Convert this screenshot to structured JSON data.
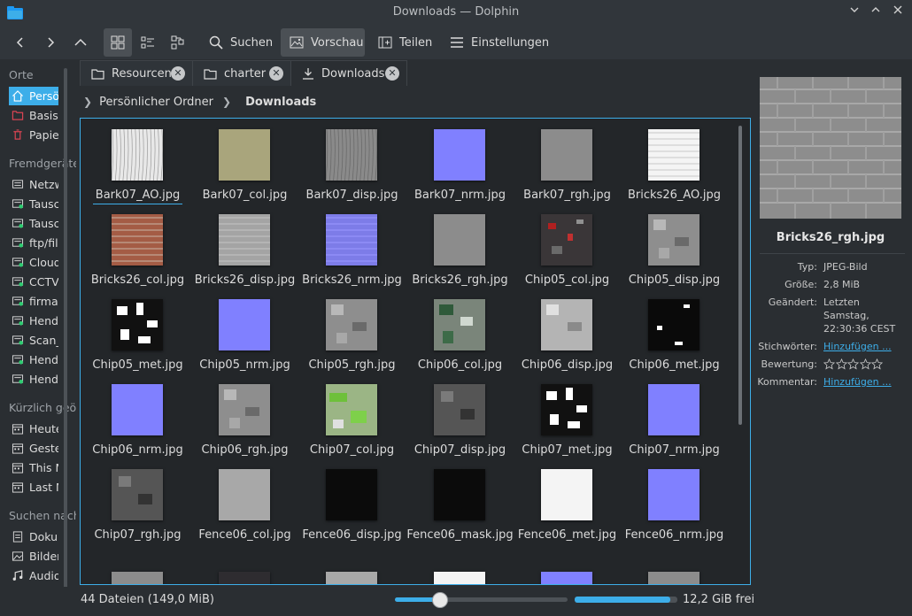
{
  "window": {
    "title": "Downloads — Dolphin"
  },
  "toolbar": {
    "search_label": "Suchen",
    "preview_label": "Vorschau",
    "share_label": "Teilen",
    "settings_label": "Einstellungen"
  },
  "sidebar": {
    "sections": [
      {
        "label": "Orte",
        "items": [
          {
            "label": "Persönlicher Ordner",
            "icon": "home-icon",
            "selected": true
          },
          {
            "label": "Basisordner",
            "icon": "folder-red-icon"
          },
          {
            "label": "Papierkorb",
            "icon": "trash-icon"
          }
        ]
      },
      {
        "label": "Fremdgeräte",
        "items": [
          {
            "label": "Netzwerk",
            "icon": "network-icon"
          },
          {
            "label": "Tauschordner",
            "icon": "network-folder-icon"
          },
          {
            "label": "Tauschordner",
            "icon": "network-folder-icon"
          },
          {
            "label": "ftp/files",
            "icon": "network-folder-icon"
          },
          {
            "label": "Cloud",
            "icon": "network-folder-icon"
          },
          {
            "label": "CCTV",
            "icon": "network-folder-icon"
          },
          {
            "label": "firma",
            "icon": "network-folder-icon"
          },
          {
            "label": "Hendrik",
            "icon": "network-folder-icon"
          },
          {
            "label": "Scan_",
            "icon": "network-folder-icon"
          },
          {
            "label": "Hendrik",
            "icon": "network-folder-icon"
          },
          {
            "label": "Hendrik",
            "icon": "network-folder-icon"
          }
        ]
      },
      {
        "label": "Kürzlich geöffnet",
        "items": [
          {
            "label": "Heute",
            "icon": "calendar-icon"
          },
          {
            "label": "Gestern",
            "icon": "calendar-icon"
          },
          {
            "label": "This Month",
            "icon": "calendar-icon"
          },
          {
            "label": "Last Month",
            "icon": "calendar-icon"
          }
        ]
      },
      {
        "label": "Suchen nach",
        "items": [
          {
            "label": "Dokumente",
            "icon": "document-icon"
          },
          {
            "label": "Bilder",
            "icon": "image-icon"
          },
          {
            "label": "Audio",
            "icon": "audio-icon"
          }
        ]
      }
    ]
  },
  "tabs": [
    {
      "label": "Resourcen",
      "icon": "folder-icon"
    },
    {
      "label": "charter",
      "icon": "folder-icon"
    },
    {
      "label": "Downloads",
      "icon": "download-icon",
      "active": true
    }
  ],
  "breadcrumb": {
    "parent": "Persönlicher Ordner",
    "current": "Downloads"
  },
  "files": [
    {
      "name": "Bark07_AO.jpg",
      "swatch": "bark-ao",
      "selected": true
    },
    {
      "name": "Bark07_col.jpg",
      "swatch": "bark-col"
    },
    {
      "name": "Bark07_disp.jpg",
      "swatch": "bark-disp"
    },
    {
      "name": "Bark07_nrm.jpg",
      "swatch": "nrm"
    },
    {
      "name": "Bark07_rgh.jpg",
      "swatch": "grey-mid"
    },
    {
      "name": "Bricks26_AO.jpg",
      "swatch": "bricks-ao"
    },
    {
      "name": "Bricks26_col.jpg",
      "swatch": "bricks-col"
    },
    {
      "name": "Bricks26_disp.jpg",
      "swatch": "bricks-disp"
    },
    {
      "name": "Bricks26_nrm.jpg",
      "swatch": "bricks-nrm"
    },
    {
      "name": "Bricks26_rgh.jpg",
      "swatch": "grey-mid"
    },
    {
      "name": "Chip05_col.jpg",
      "swatch": "chip-col"
    },
    {
      "name": "Chip05_disp.jpg",
      "swatch": "chip-disp"
    },
    {
      "name": "Chip05_met.jpg",
      "swatch": "chip-met"
    },
    {
      "name": "Chip05_nrm.jpg",
      "swatch": "nrm"
    },
    {
      "name": "Chip05_rgh.jpg",
      "swatch": "chip-disp"
    },
    {
      "name": "Chip06_col.jpg",
      "swatch": "chip06-col"
    },
    {
      "name": "Chip06_disp.jpg",
      "swatch": "chip-light"
    },
    {
      "name": "Chip06_met.jpg",
      "swatch": "chip-met-dark"
    },
    {
      "name": "Chip06_nrm.jpg",
      "swatch": "nrm"
    },
    {
      "name": "Chip06_rgh.jpg",
      "swatch": "chip-disp"
    },
    {
      "name": "Chip07_col.jpg",
      "swatch": "chip07-col"
    },
    {
      "name": "Chip07_disp.jpg",
      "swatch": "chip-dark"
    },
    {
      "name": "Chip07_met.jpg",
      "swatch": "chip-met"
    },
    {
      "name": "Chip07_nrm.jpg",
      "swatch": "nrm"
    },
    {
      "name": "Chip07_rgh.jpg",
      "swatch": "chip-dark"
    },
    {
      "name": "Fence06_col.jpg",
      "swatch": "grey-light"
    },
    {
      "name": "Fence06_disp.jpg",
      "swatch": "black"
    },
    {
      "name": "Fence06_mask.jpg",
      "swatch": "black"
    },
    {
      "name": "Fence06_met.jpg",
      "swatch": "white"
    },
    {
      "name": "Fence06_nrm.jpg",
      "swatch": "nrm"
    },
    {
      "name": "",
      "swatch": "grey-mid"
    },
    {
      "name": "",
      "swatch": "dark"
    },
    {
      "name": "",
      "swatch": "grey-light"
    },
    {
      "name": "",
      "swatch": "white"
    },
    {
      "name": "",
      "swatch": "nrm"
    },
    {
      "name": "",
      "swatch": "grey-mid"
    }
  ],
  "swatches": {
    "bark-ao": "#e6e6e6",
    "bark-col": "#a9a57c",
    "bark-disp": "#8a8a8a",
    "nrm": "#8080ff",
    "grey-mid": "#8c8c8c",
    "bricks-ao": "#f2f2f2",
    "bricks-col": "#a45c45",
    "bricks-disp": "#a4a4a4",
    "bricks-nrm": "#7d7ce8",
    "chip-col": "#3a3638",
    "chip-disp": "#8e8e8e",
    "chip-met": "#111111",
    "chip06-col": "#7a857a",
    "chip-light": "#b4b4b4",
    "chip-met-dark": "#0a0a0a",
    "chip07-col": "#9bb585",
    "chip-dark": "#555555",
    "grey-light": "#a8a8a8",
    "black": "#0b0b0b",
    "white": "#f4f4f4",
    "dark": "#2e2c30"
  },
  "status": {
    "count": "44 Dateien (149,0 MiB)",
    "free": "12,2 GiB frei",
    "zoom_fraction": 0.26,
    "used_fraction": 0.93
  },
  "info": {
    "name": "Bricks26_rgh.jpg",
    "type_key": "Typ:",
    "type_val": "JPEG-Bild",
    "size_key": "Größe:",
    "size_val": "2,8 MiB",
    "modified_key": "Geändert:",
    "modified_line1": "Letzten",
    "modified_line2": "Samstag,",
    "modified_line3": "22:30:36 CEST",
    "tags_key": "Stichwörter:",
    "tags_val": "Hinzufügen ...",
    "rating_key": "Bewertung:",
    "rating": 0,
    "comment_key": "Kommentar:",
    "comment_val": "Hinzufügen ..."
  },
  "colors": {
    "accent": "#3daee9",
    "bg": "#2a2e32",
    "view_bg": "#232629",
    "toolbar_bg": "#31363b"
  }
}
